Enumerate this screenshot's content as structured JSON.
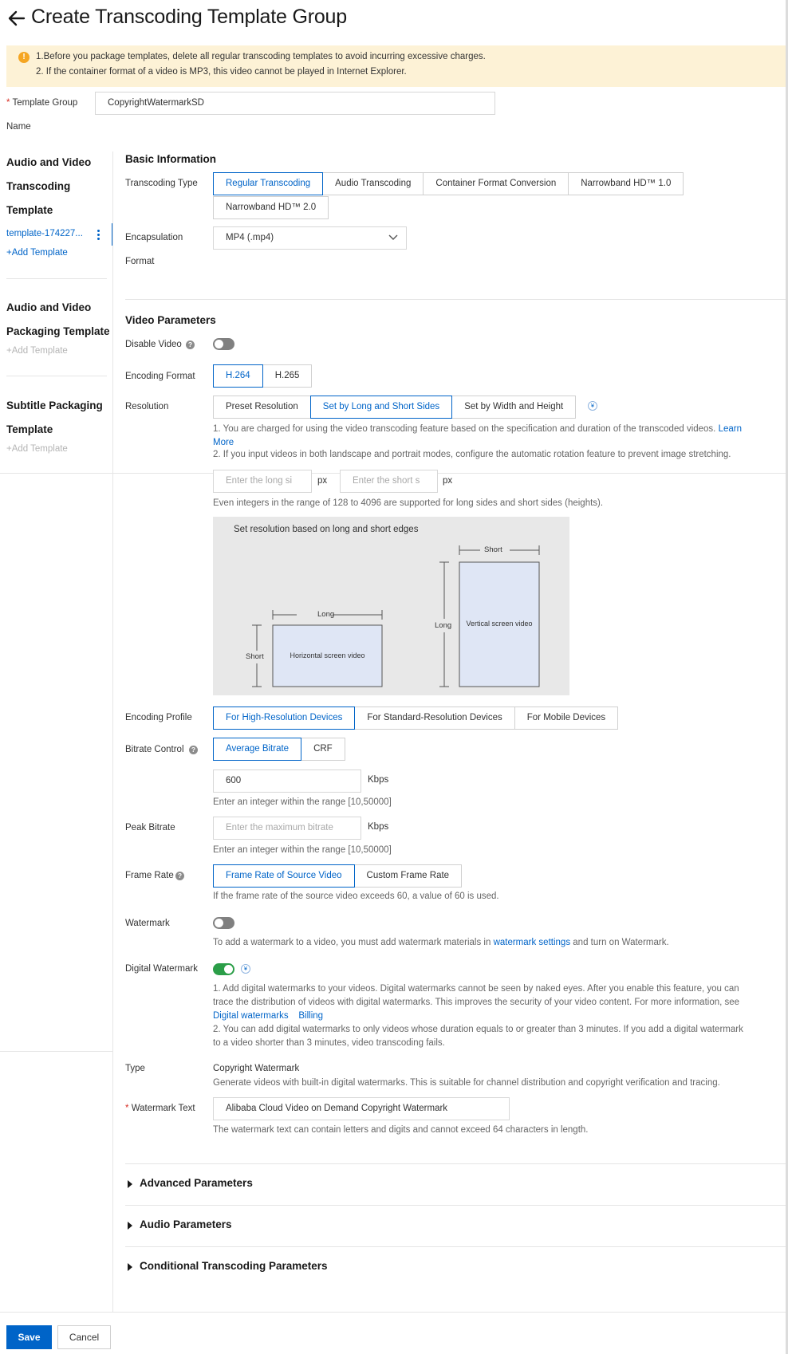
{
  "header": {
    "title": "Create Transcoding Template Group"
  },
  "notice": {
    "line1": "1.Before you package templates, delete all regular transcoding templates to avoid incurring excessive charges.",
    "line2": "2. If the container format of a video is MP3, this video cannot be played in Internet Explorer."
  },
  "group_name": {
    "label_line1": "Template Group",
    "label_line2": "Name",
    "required_mark": "*",
    "value": "CopyrightWatermarkSD"
  },
  "sidebar": {
    "transcoding": {
      "title_line1": "Audio and Video",
      "title_line2": "Transcoding",
      "title_line3": "Template",
      "item": "template-174227...",
      "add": "+Add Template"
    },
    "packaging": {
      "title_line1": "Audio and Video",
      "title_line2": "Packaging Template",
      "add": "+Add Template"
    },
    "subtitle": {
      "title_line1": "Subtitle Packaging",
      "title_line2": "Template",
      "add": "+Add Template"
    }
  },
  "basic": {
    "title": "Basic Information",
    "transcoding_type_label": "Transcoding Type",
    "transcoding_types": [
      "Regular Transcoding",
      "Audio Transcoding",
      "Container Format Conversion",
      "Narrowband HD™ 1.0",
      "Narrowband HD™ 2.0"
    ],
    "encapsulation_label_line1": "Encapsulation",
    "encapsulation_label_line2": "Format",
    "encapsulation_value": "MP4 (.mp4)"
  },
  "video": {
    "title": "Video Parameters",
    "disable_label": "Disable Video",
    "disable_on": false,
    "encoding_format_label": "Encoding Format",
    "encoding_formats": [
      "H.264",
      "H.265"
    ],
    "resolution_label": "Resolution",
    "resolution_options": [
      "Preset Resolution",
      "Set by Long and Short Sides",
      "Set by Width and Height"
    ],
    "resolution_note1_a": "1. You are charged for using the video transcoding feature based on the specification and duration of the transcoded videos.",
    "resolution_note1_link_a": "Learn",
    "resolution_note1_link_b": "More",
    "resolution_note2": "2. If you input videos in both landscape and portrait modes, configure the automatic rotation feature to prevent image stretching.",
    "long_side_placeholder": "Enter the long si",
    "short_side_placeholder": "Enter the short s",
    "unit_px": "px",
    "range_note": "Even integers in the range of 128 to 4096 are supported for long sides and short sides (heights).",
    "illustration": {
      "title": "Set resolution based on long and short edges",
      "long": "Long",
      "short": "Short",
      "horizontal": "Horizontal screen video",
      "vertical": "Vertical screen video"
    },
    "encoding_profile_label": "Encoding Profile",
    "encoding_profiles": [
      "For High-Resolution Devices",
      "For Standard-Resolution Devices",
      "For Mobile Devices"
    ],
    "bitrate_control_label": "Bitrate Control",
    "bitrate_controls": [
      "Average Bitrate",
      "CRF"
    ],
    "bitrate_value": "600",
    "unit_kbps": "Kbps",
    "bitrate_note": "Enter an integer within the range [10,50000]",
    "peak_bitrate_label": "Peak Bitrate",
    "peak_bitrate_placeholder": "Enter the maximum bitrate",
    "peak_note": "Enter an integer within the range [10,50000]",
    "frame_rate_label": "Frame Rate",
    "frame_rates": [
      "Frame Rate of Source Video",
      "Custom Frame Rate"
    ],
    "frame_rate_note": "If the frame rate of the source video exceeds 60, a value of 60 is used.",
    "watermark_label": "Watermark",
    "watermark_on": false,
    "watermark_note_a": "To add a watermark to a video, you must add watermark materials in",
    "watermark_note_link": "watermark settings",
    "watermark_note_b": "and turn on Watermark.",
    "digital_label": "Digital Watermark",
    "digital_on": true,
    "digital_note1_l1": "1. Add digital watermarks to your videos. Digital watermarks cannot be seen by naked eyes. After you enable this feature, you can",
    "digital_note1_l2": "trace the distribution of videos with digital watermarks. This improves the security of your video content. For more information, see",
    "digital_link1": "Digital watermarks",
    "digital_link2": "Billing",
    "digital_note2_l1": "2. You can add digital watermarks to only videos whose duration equals to or greater than 3 minutes. If you add a digital watermark",
    "digital_note2_l2": "to a video shorter than 3 minutes, video transcoding fails.",
    "type_label": "Type",
    "type_value": "Copyright Watermark",
    "type_note": "Generate videos with built-in digital watermarks. This is suitable for channel distribution and copyright verification and tracing.",
    "wm_text_label": "Watermark Text",
    "wm_text_value": "Alibaba Cloud Video on Demand Copyright Watermark",
    "wm_text_note": "The watermark text can contain letters and digits and cannot exceed 64 characters in length."
  },
  "sections": {
    "advanced": "Advanced Parameters",
    "audio": "Audio Parameters",
    "conditional": "Conditional Transcoding Parameters"
  },
  "footer": {
    "save": "Save",
    "cancel": "Cancel"
  },
  "colors": {
    "accent": "#0064c8",
    "notice_bg": "#fdf2d6",
    "toggle_on": "#2b9e48",
    "required": "#d93026"
  }
}
